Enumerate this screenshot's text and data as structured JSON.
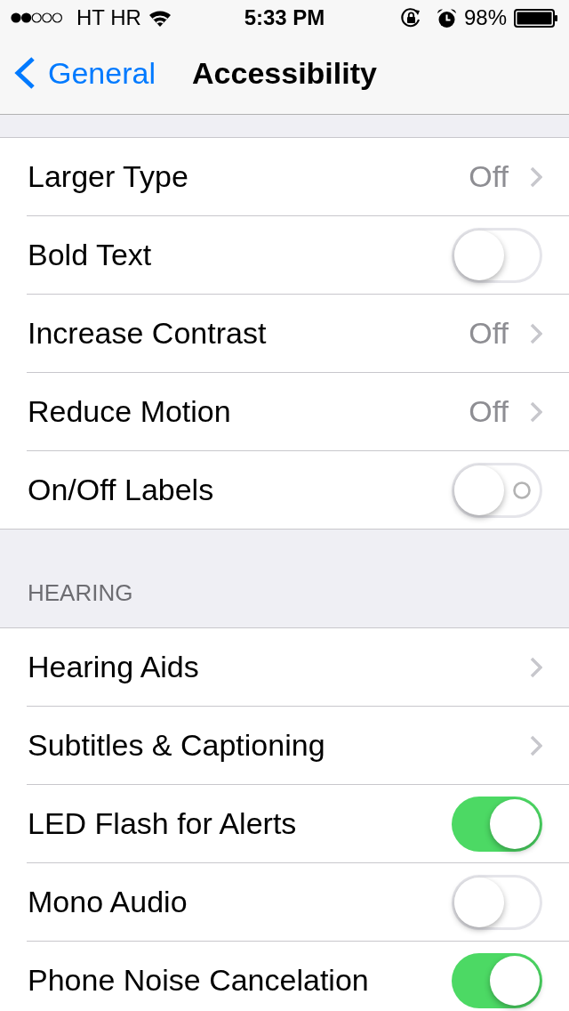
{
  "status_bar": {
    "carrier": "HT HR",
    "time": "5:33 PM",
    "battery": "98%"
  },
  "nav_bar": {
    "back_label": "General",
    "title": "Accessibility"
  },
  "groups": [
    {
      "items": [
        {
          "kind": "disclosure",
          "label": "Larger Type",
          "value": "Off"
        },
        {
          "kind": "toggle",
          "label": "Bold Text",
          "on": false
        },
        {
          "kind": "disclosure",
          "label": "Increase Contrast",
          "value": "Off"
        },
        {
          "kind": "disclosure",
          "label": "Reduce Motion",
          "value": "Off"
        },
        {
          "kind": "labeled-toggle",
          "label": "On/Off Labels",
          "on": false
        }
      ]
    },
    {
      "header": "HEARING",
      "items": [
        {
          "kind": "disclosure",
          "label": "Hearing Aids"
        },
        {
          "kind": "disclosure",
          "label": "Subtitles & Captioning"
        },
        {
          "kind": "toggle",
          "label": "LED Flash for Alerts",
          "on": true
        },
        {
          "kind": "toggle",
          "label": "Mono Audio",
          "on": false
        },
        {
          "kind": "toggle",
          "label": "Phone Noise Cancelation",
          "on": true
        }
      ]
    }
  ]
}
